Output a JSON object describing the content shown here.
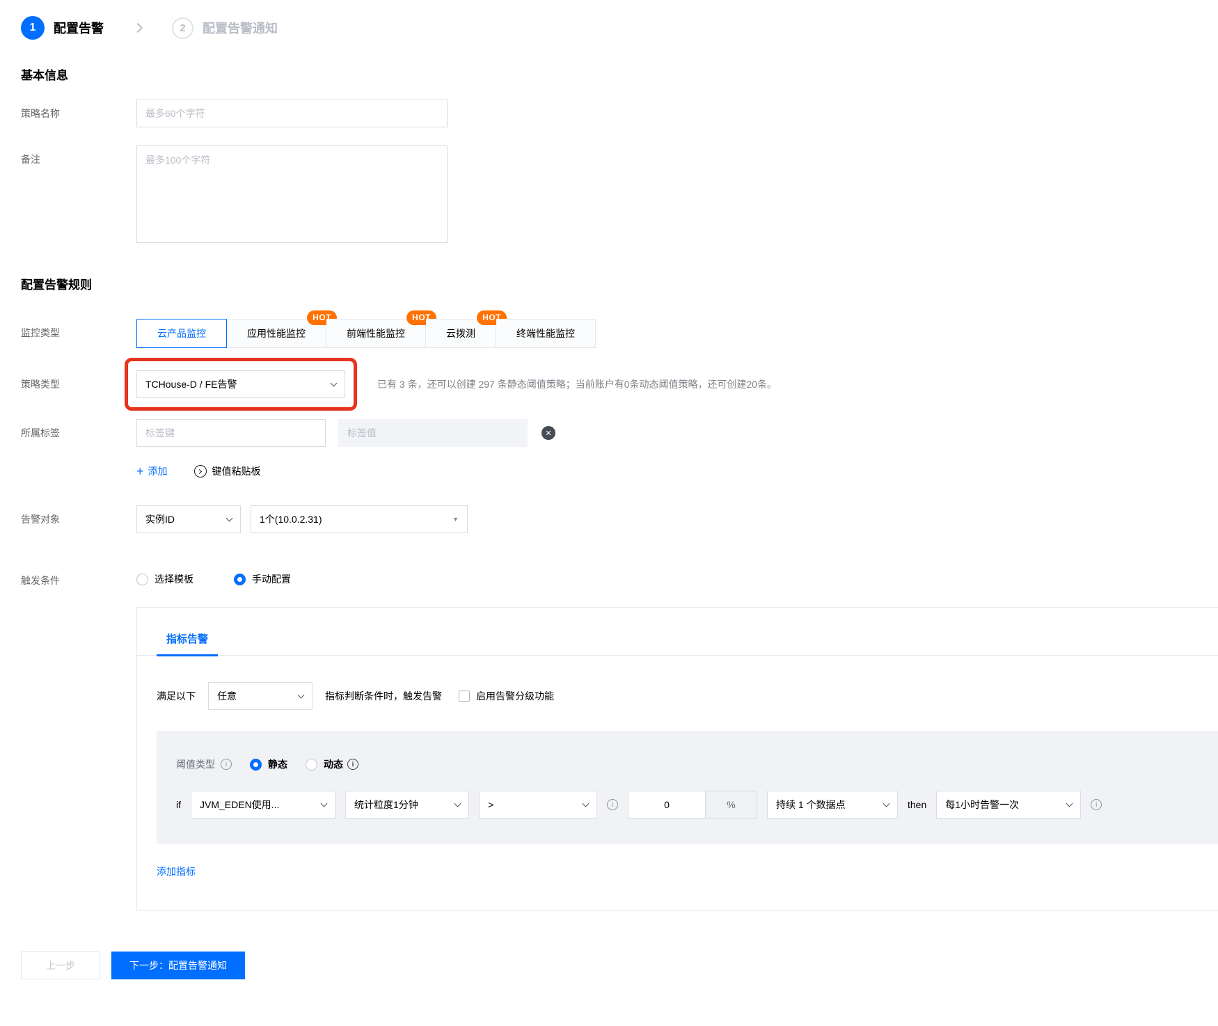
{
  "colors": {
    "accent": "#006eff",
    "hot_badge": "#ff7201",
    "annotation_red": "#e6341e",
    "panel_gray": "#f1f2f6"
  },
  "stepper": {
    "step1_number": "1",
    "step1_label": "配置告警",
    "step2_number": "2",
    "step2_label": "配置告警通知"
  },
  "basic_info": {
    "title": "基本信息",
    "policy_name_label": "策略名称",
    "policy_name_placeholder": "最多60个字符",
    "remark_label": "备注",
    "remark_placeholder": "最多100个字符"
  },
  "rules": {
    "title": "配置告警规则",
    "monitor_type_label": "监控类型",
    "hot_badge": "HOT",
    "tabs": [
      {
        "label": "云产品监控"
      },
      {
        "label": "应用性能监控"
      },
      {
        "label": "前端性能监控"
      },
      {
        "label": "云拨测"
      },
      {
        "label": "终端性能监控"
      }
    ],
    "policy_type_label": "策略类型",
    "policy_type_value": "TCHouse-D / FE告警",
    "policy_type_hint": "已有 3 条，还可以创建 297 条静态阈值策略；当前账户有0条动态阈值策略，还可创建20条。",
    "tags_label": "所属标签",
    "tag_key_placeholder": "标签键",
    "tag_value_placeholder": "标签值",
    "add_tag_label": "添加",
    "paste_board_label": "键值粘贴板",
    "alarm_object_label": "告警对象",
    "object_type_value": "实例ID",
    "object_value": "1个(10.0.2.31)",
    "trigger_label": "触发条件",
    "trigger_template_option": "选择模板",
    "trigger_manual_option": "手动配置"
  },
  "metric_panel": {
    "tab_label": "指标告警",
    "meet_prefix": "满足以下",
    "meet_select_value": "任意",
    "meet_suffix": "指标判断条件时，触发告警",
    "grading_checkbox_label": "启用告警分级功能",
    "threshold_label": "阈值类型",
    "static_option": "静态",
    "dynamic_option": "动态",
    "if_label": "if",
    "metric_value": "JVM_EDEN使用...",
    "granularity_value": "统计粒度1分钟",
    "operator_value": ">",
    "threshold_value": "0",
    "unit": "%",
    "duration_value": "持续 1 个数据点",
    "then_label": "then",
    "frequency_value": "每1小时告警一次",
    "add_metric_label": "添加指标"
  },
  "footer": {
    "prev_label": "上一步",
    "next_label": "下一步：配置告警通知"
  }
}
